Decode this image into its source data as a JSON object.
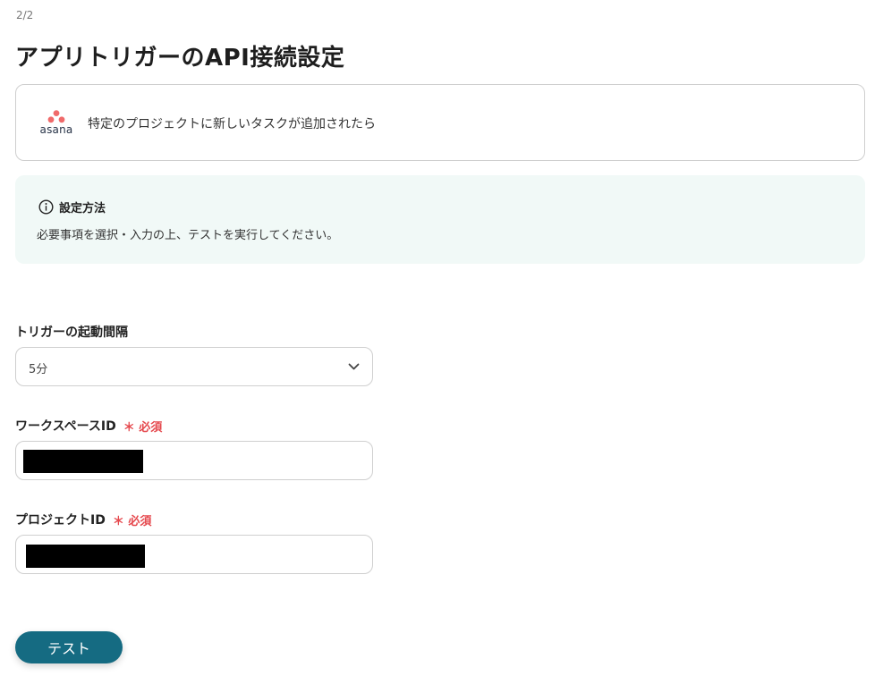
{
  "step_indicator": "2/2",
  "page_title": "アプリトリガーのAPI接続設定",
  "trigger": {
    "app_name": "asana",
    "description": "特定のプロジェクトに新しいタスクが追加されたら",
    "icon": "asana-logo"
  },
  "info": {
    "icon": "info-icon",
    "title": "設定方法",
    "text": "必要事項を選択・入力の上、テストを実行してください。"
  },
  "fields": {
    "interval": {
      "label": "トリガーの起動間隔",
      "value": "5分"
    },
    "workspace_id": {
      "label": "ワークスペースID",
      "required": "＊ 必須"
    },
    "project_id": {
      "label": "プロジェクトID",
      "required": "＊ 必須"
    }
  },
  "test_button": "テスト",
  "colors": {
    "accent": "#156b82",
    "required": "#e5484d",
    "info_bg": "#f1f9f7",
    "asana": "#f06a6a"
  }
}
